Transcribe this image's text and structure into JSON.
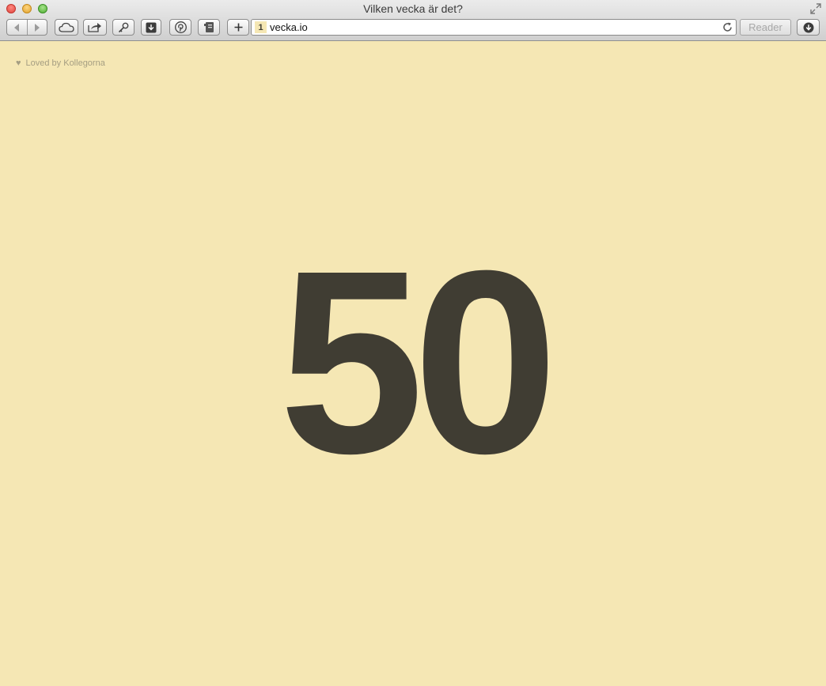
{
  "window": {
    "title": "Vilken vecka är det?"
  },
  "toolbar": {
    "back_icon": "back-arrow-icon",
    "forward_icon": "forward-arrow-icon",
    "icloud_icon": "cloud-icon",
    "share_icon": "share-icon",
    "tools_icon": "key-icon",
    "download_icon": "download-box-icon",
    "pinterest_icon": "pinterest-icon",
    "reader_list_icon": "notebook-icon",
    "new_tab_icon": "plus-icon",
    "downloads_icon": "downloads-icon",
    "reader_label": "Reader"
  },
  "address_bar": {
    "favicon_text": "1",
    "url": "vecka.io"
  },
  "page": {
    "loved_text": "Loved by Kollegorna",
    "week_number": "50",
    "colors": {
      "background": "#f5e7b4",
      "number": "#403d33",
      "muted": "#a59e82"
    }
  }
}
